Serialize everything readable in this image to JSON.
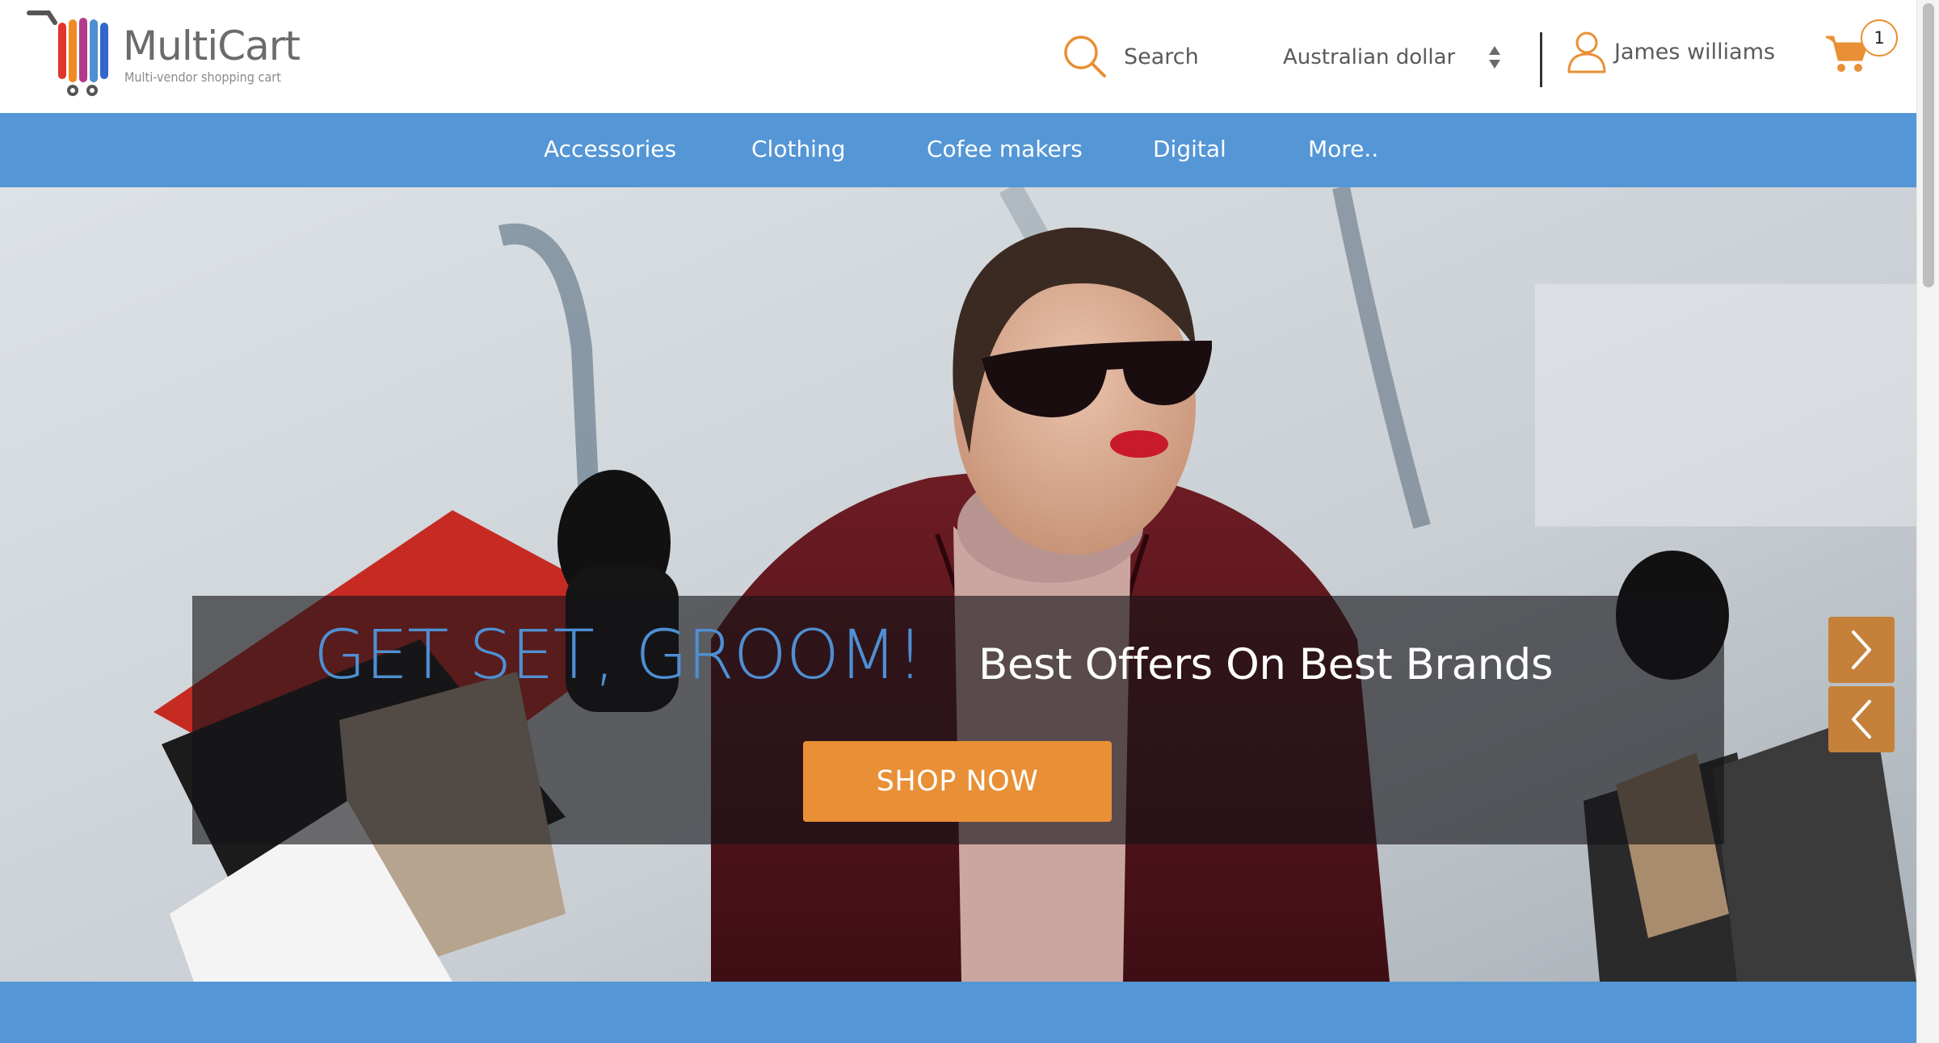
{
  "brand": {
    "name": "MultiCart",
    "tagline": "Multi-vendor shopping cart"
  },
  "header": {
    "search_label": "Search",
    "currency_label": "Australian dollar",
    "user_name": "James williams",
    "cart_count": "1"
  },
  "nav": {
    "items": [
      {
        "label": "Accessories"
      },
      {
        "label": "Clothing"
      },
      {
        "label": "Cofee makers"
      },
      {
        "label": "Digital"
      },
      {
        "label": "More.."
      }
    ]
  },
  "hero": {
    "headline": "GET SET, GROOM!",
    "subheadline": "Best Offers On Best Brands",
    "cta_label": "SHOP NOW",
    "next_icon": "chevron-right-icon",
    "prev_icon": "chevron-left-icon"
  },
  "colors": {
    "accent_blue": "#5496d6",
    "headline_blue": "#4f8fd3",
    "accent_orange": "#e98f35",
    "slider_button": "#c5813a"
  }
}
